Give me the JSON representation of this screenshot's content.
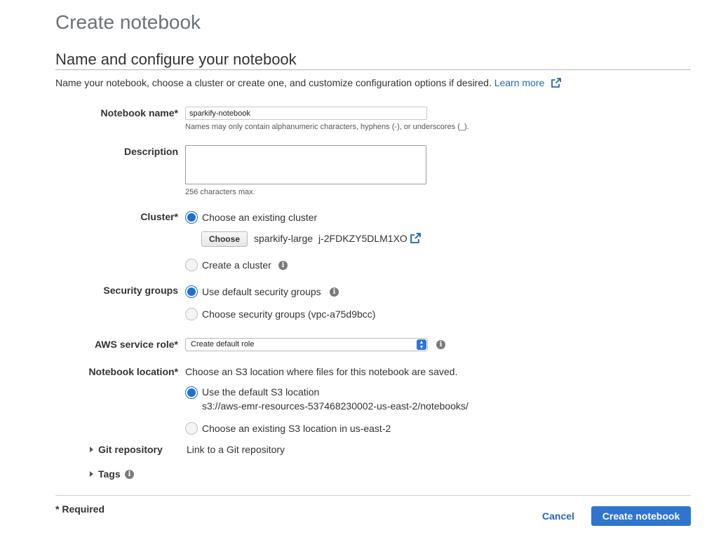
{
  "page": {
    "title": "Create notebook"
  },
  "section": {
    "title": "Name and configure your notebook",
    "intro": "Name your notebook, choose a cluster or create one, and customize configuration options if desired.",
    "learn_more": "Learn more"
  },
  "notebook_name": {
    "label": "Notebook name*",
    "value": "sparkify-notebook",
    "hint": "Names may only contain alphanumeric characters, hyphens (-), or underscores (_)."
  },
  "description": {
    "label": "Description",
    "value": "",
    "hint": "256 characters max."
  },
  "cluster": {
    "label": "Cluster*",
    "option_existing": "Choose an existing cluster",
    "choose_button": "Choose",
    "selected_name": "sparkify-large",
    "selected_id": "j-2FDKZY5DLM1XO",
    "option_create": "Create a cluster"
  },
  "security_groups": {
    "label": "Security groups",
    "option_default": "Use default security groups",
    "option_choose": "Choose security groups (vpc-a75d9bcc)"
  },
  "service_role": {
    "label": "AWS service role*",
    "selected": "Create default role"
  },
  "location": {
    "label": "Notebook location*",
    "description": "Choose an S3 location where files for this notebook are saved.",
    "option_default": "Use the default S3 location",
    "default_path": "s3://aws-emr-resources-537468230002-us-east-2/notebooks/",
    "option_existing": "Choose an existing S3 location in us-east-2"
  },
  "git": {
    "label": "Git repository",
    "text": "Link to a Git repository"
  },
  "tags": {
    "label": "Tags"
  },
  "footer": {
    "required": "* Required",
    "cancel": "Cancel",
    "create": "Create notebook"
  },
  "colors": {
    "accent": "#2f74cf",
    "link": "#2467b6",
    "radio_checked": "#1e6fd6"
  }
}
